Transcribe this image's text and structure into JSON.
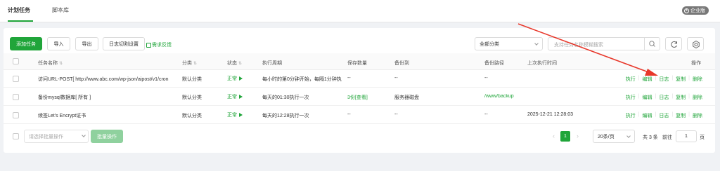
{
  "tabs": [
    {
      "label": "计划任务",
      "active": true
    },
    {
      "label": "脚本库",
      "active": false
    }
  ],
  "enterprise_badge": "企业版",
  "toolbar": {
    "add_task": "添加任务",
    "import": "导入",
    "export": "导出",
    "log_rotate": "日志切割设置",
    "feedback": "需求反馈",
    "category_select": "全部分类",
    "search_placeholder": "支持任务名称模糊搜索"
  },
  "table": {
    "headers": {
      "name": "任务名称",
      "category": "分类",
      "status": "状态",
      "cycle": "执行周期",
      "keep": "保存数量",
      "backup_to": "备份到",
      "backup_path": "备份路径",
      "last_run": "上次执行时间",
      "ops": "操作"
    },
    "rows": [
      {
        "name": "访问URL-POST[ http://www.abc.com/wp-json/aipost/v1/cron",
        "category": "默认分类",
        "status": "正常",
        "cycle": "每小时的第0分钟开始，每隔1分钟执",
        "keep": "--",
        "backup_to": "--",
        "backup_path": "--",
        "last_run": ""
      },
      {
        "name": "备份mysql数据库[ 所有 ]",
        "category": "默认分类",
        "status": "正常",
        "cycle": "每天的01:30执行一次",
        "keep": "3份[查看]",
        "backup_to": "服务器磁盘",
        "backup_path": "/www/backup",
        "last_run": ""
      },
      {
        "name": "续签Let's Encrypt证书",
        "category": "默认分类",
        "status": "正常",
        "cycle": "每天的12:28执行一次",
        "keep": "--",
        "backup_to": "--",
        "backup_path": "--",
        "last_run": "2025-12-21 12:28:03"
      }
    ],
    "ops": [
      "执行",
      "编辑",
      "日志",
      "复制",
      "删除"
    ]
  },
  "footer": {
    "batch_placeholder": "请选择批量操作",
    "batch_button": "批量操作",
    "current_page": "1",
    "page_size": "20条/页",
    "total": "共 3 条",
    "goto_label": "前往",
    "goto_value": "1",
    "page_unit": "页"
  },
  "colors": {
    "accent": "#20a53a",
    "annotation_arrow": "#e8382b"
  }
}
